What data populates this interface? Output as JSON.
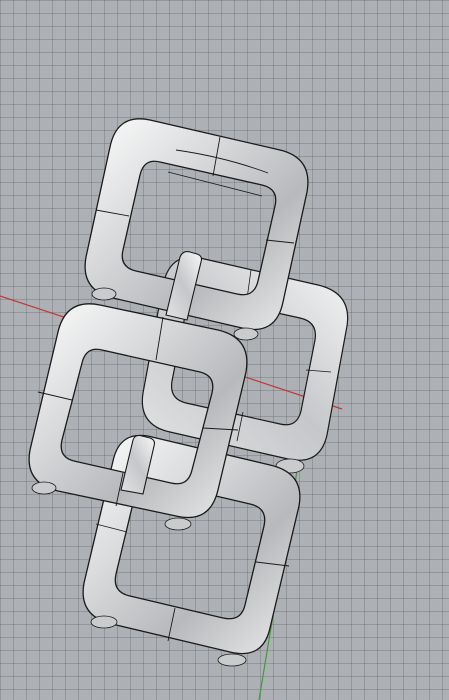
{
  "viewport": {
    "view": "perspective",
    "grid_visible": true,
    "x_axis_color": "#c0383a",
    "y_axis_color": "#3f9a3f"
  },
  "model": {
    "object": "chain-link-frames",
    "link_count": 4,
    "shading": "silver-glossy",
    "edge_color": "#1a1a1a"
  }
}
